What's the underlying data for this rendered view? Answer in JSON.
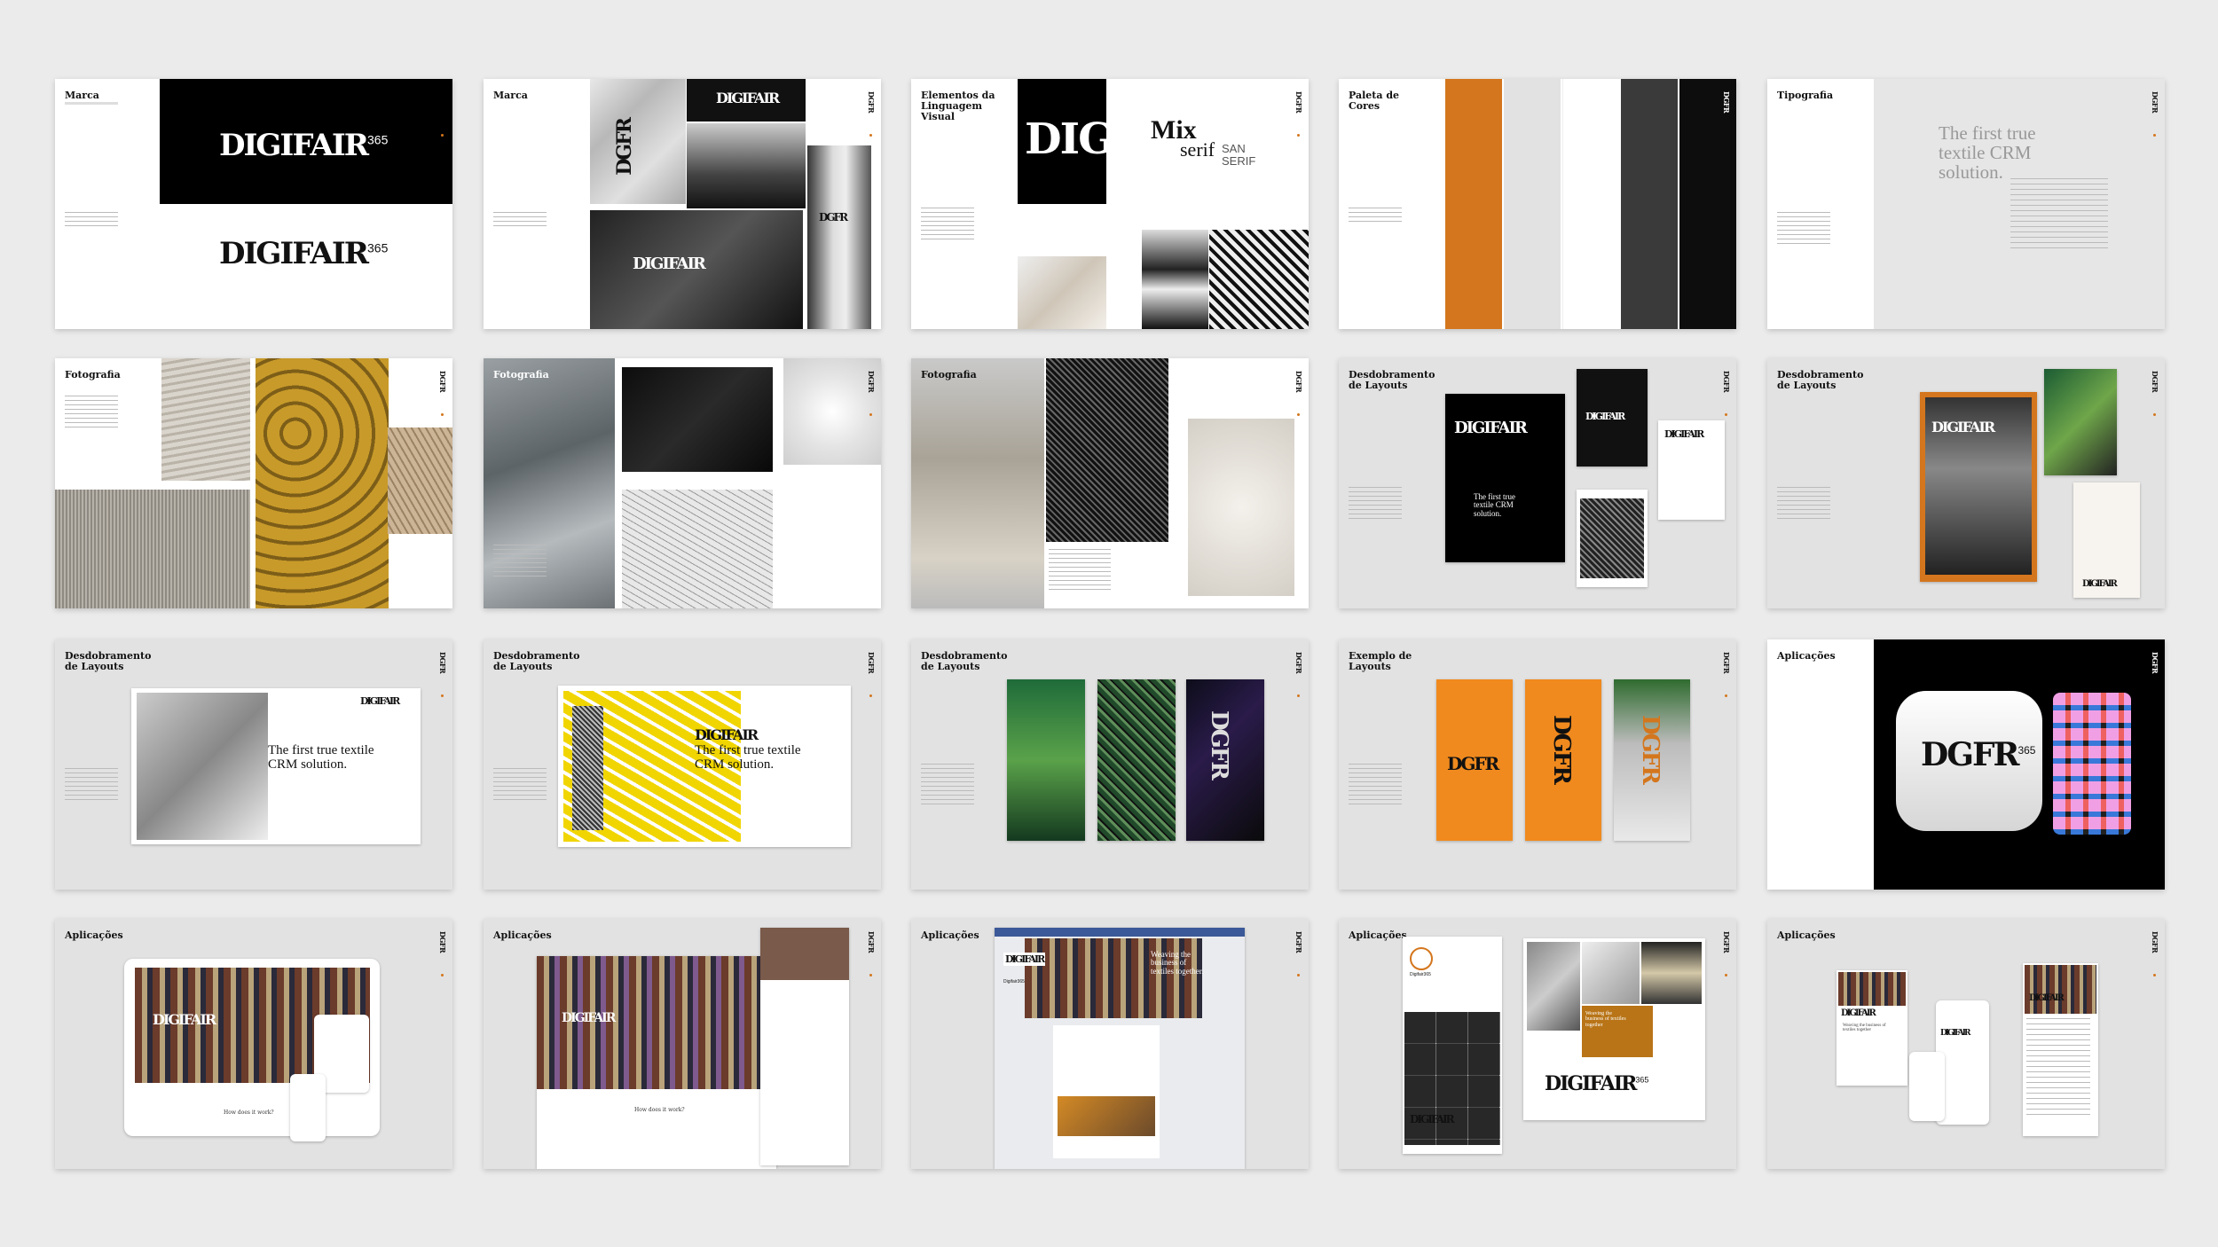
{
  "brand": {
    "logo": "DIGIFAIR",
    "logo_sup": "365",
    "dgfr": "DGFR",
    "dgfr_sup": "365",
    "digi": "DIGI"
  },
  "colors": {
    "orange": "#d4761d",
    "black": "#111111",
    "gray": "#e2e2e2"
  },
  "slides": {
    "s1": {
      "title": "Marca"
    },
    "s2": {
      "title": "Marca"
    },
    "s3": {
      "title": "Elementos da Linguagem Visual",
      "mix": "Mix",
      "serif": "serif",
      "sans": "SAN SERIF"
    },
    "s4": {
      "title": "Paleta de Cores"
    },
    "s5": {
      "title": "Tipografia",
      "headline": "The first true textile CRM solution."
    },
    "s6": {
      "title": "Fotografia"
    },
    "s7": {
      "title": "Fotografia"
    },
    "s8": {
      "title": "Fotografia"
    },
    "s9": {
      "title": "Desdobramento de Layouts",
      "tagline": "The first true textile CRM solution."
    },
    "s10": {
      "title": "Desdobramento de Layouts"
    },
    "s11": {
      "title": "Desdobramento de Layouts",
      "headline": "The first true textile CRM solution."
    },
    "s12": {
      "title": "Desdobramento de Layouts",
      "headline": "The first true textile CRM solution."
    },
    "s13": {
      "title": "Desdobramento de Layouts"
    },
    "s14": {
      "title": "Exemplo de Layouts"
    },
    "s15": {
      "title": "Aplicações"
    },
    "s16": {
      "title": "Aplicações",
      "caption": "How does it work?"
    },
    "s17": {
      "title": "Aplicações",
      "caption": "How does it work?"
    },
    "s18": {
      "title": "Aplicações",
      "fb_headline": "Weaving the business of textiles together.",
      "fb_name": "Digifair365"
    },
    "s19": {
      "title": "Aplicações",
      "ig_name": "Digifair365",
      "card_text": "Weaving the business of textiles together"
    },
    "s20": {
      "title": "Aplicações",
      "card_text": "Weaving the business of textiles together"
    }
  }
}
